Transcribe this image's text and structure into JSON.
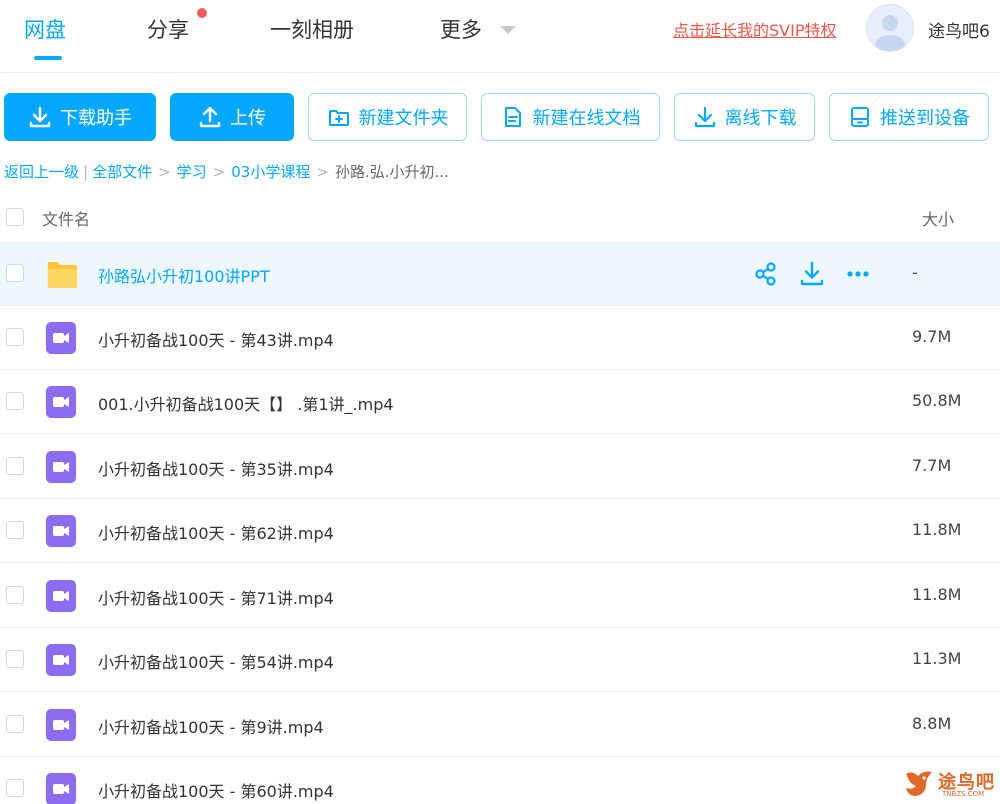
{
  "nav": {
    "tabs": [
      {
        "label": "网盘",
        "active": true
      },
      {
        "label": "分享",
        "badge_dot": true
      },
      {
        "label": "一刻相册"
      },
      {
        "label": "更多"
      }
    ],
    "svip_link": "点击延长我的SVIP特权",
    "username": "途鸟吧6"
  },
  "toolbar": {
    "buttons": [
      {
        "label": "下载助手",
        "icon": "download-icon",
        "style": "primary"
      },
      {
        "label": "上传",
        "icon": "upload-icon",
        "style": "primary"
      },
      {
        "label": "新建文件夹",
        "icon": "new-folder-icon",
        "style": "outline"
      },
      {
        "label": "新建在线文档",
        "icon": "document-icon",
        "style": "outline"
      },
      {
        "label": "离线下载",
        "icon": "offline-download-icon",
        "style": "outline"
      },
      {
        "label": "推送到设备",
        "icon": "device-icon",
        "style": "outline"
      }
    ]
  },
  "breadcrumb": {
    "back": "返回上一级",
    "items": [
      "全部文件",
      "学习",
      "03小学课程"
    ],
    "current": "孙路.弘.小升初..."
  },
  "list": {
    "columns": {
      "name": "文件名",
      "size": "大小"
    },
    "rows": [
      {
        "name": "孙路弘小升初100讲PPT",
        "size": "-",
        "type": "folder",
        "highlight": true
      },
      {
        "name": "小升初备战100天 - 第43讲.mp4",
        "size": "9.7M",
        "type": "video"
      },
      {
        "name": "001.小升初备战100天【】 .第1讲_.mp4",
        "size": "50.8M",
        "type": "video"
      },
      {
        "name": "小升初备战100天 - 第35讲.mp4",
        "size": "7.7M",
        "type": "video"
      },
      {
        "name": "小升初备战100天 - 第62讲.mp4",
        "size": "11.8M",
        "type": "video"
      },
      {
        "name": "小升初备战100天 - 第71讲.mp4",
        "size": "11.8M",
        "type": "video"
      },
      {
        "name": "小升初备战100天 - 第54讲.mp4",
        "size": "11.3M",
        "type": "video"
      },
      {
        "name": "小升初备战100天 - 第9讲.mp4",
        "size": "8.8M",
        "type": "video"
      },
      {
        "name": "小升初备战100天 - 第60讲.mp4",
        "size": "",
        "type": "video"
      }
    ],
    "row_actions": [
      "share-icon",
      "download-icon",
      "more-icon"
    ]
  },
  "watermark": {
    "text": "途鸟吧",
    "sub": "TNBZS.COM"
  },
  "colors": {
    "accent": "#06a7ff",
    "svip_link": "#f0584b",
    "folder": "#ffc53d",
    "video": "#8c6cf0",
    "row_highlight": "#eef7fe"
  }
}
